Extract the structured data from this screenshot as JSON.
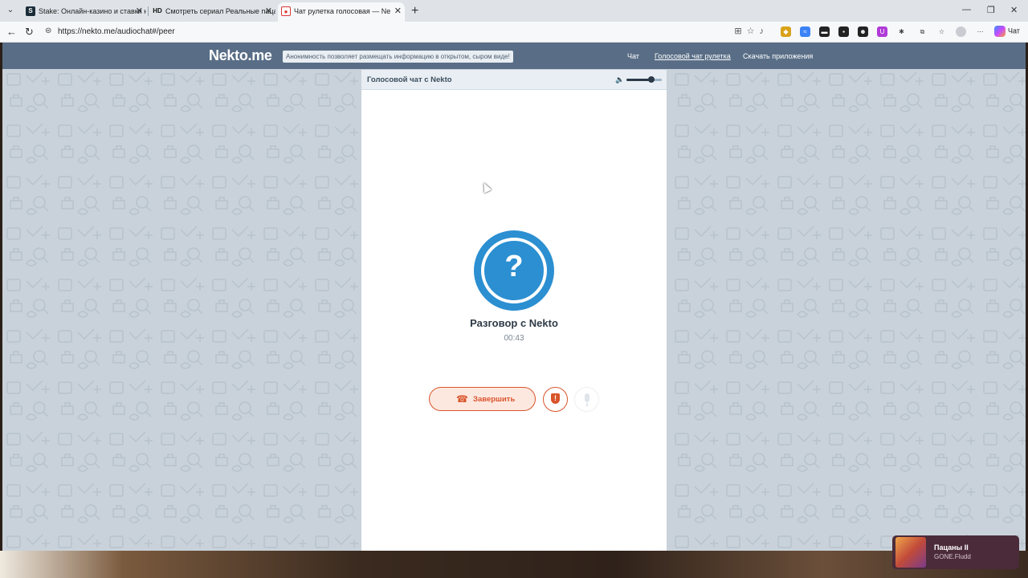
{
  "browser": {
    "tabs": [
      {
        "favicon": "S",
        "label": "Stake: Онлайн-казино и ставки н"
      },
      {
        "favicon": "HD",
        "label": "Смотреть сериал Реальные пацан"
      },
      {
        "favicon": "",
        "label": "Чат рулетка голосовая — Ne"
      }
    ],
    "url": "https://nekto.me/audiochat#/peer",
    "copilot_label": "Чат"
  },
  "site": {
    "logo": "Nekto.me",
    "tagline": "Анонимность позволяет размещать информацию в открытом, сыром виде!",
    "nav": [
      {
        "label": "Чат"
      },
      {
        "label": "Голосовой чат рулетка"
      },
      {
        "label": "Скачать приложения"
      }
    ]
  },
  "chat": {
    "title": "Голосовой чат с Nekto",
    "volume_level": 0.7,
    "avatar_glyph": "?",
    "peer_name": "Разговор с Nekto",
    "timer": "00:43",
    "end_label": "Завершить",
    "report_glyph": "!"
  },
  "media": {
    "title": "Пацаны II",
    "artist": "GONE.Fludd"
  },
  "colors": {
    "header": "#596e86",
    "accent_blue": "#2b8fd1",
    "danger": "#d9542b"
  }
}
